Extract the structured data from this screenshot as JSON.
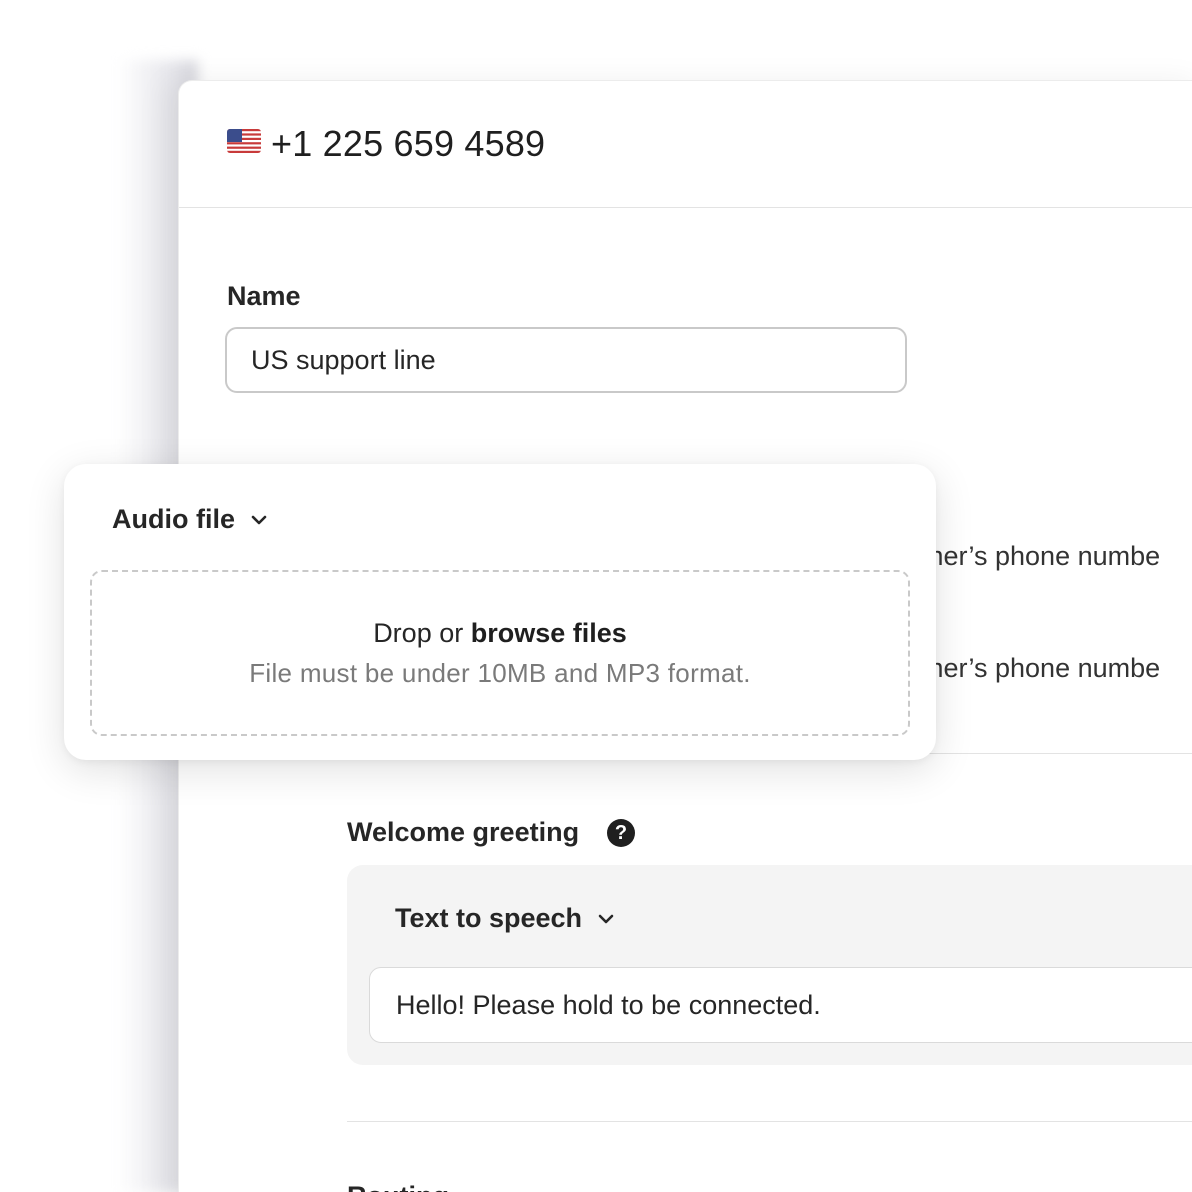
{
  "header": {
    "flag_icon": "us-flag-icon",
    "phone_number": "+1 225 659 4589"
  },
  "name_field": {
    "label": "Name",
    "value": "US support line"
  },
  "partial_text": {
    "line_1": "mer’s phone numbe",
    "line_2": "mer’s phone numbe"
  },
  "welcome_greeting": {
    "label": "Welcome greeting",
    "help_icon": "?",
    "mode_label": "Text to speech",
    "message_value": "Hello! Please hold to be connected."
  },
  "next_section": {
    "label": "Routing"
  },
  "audio_card": {
    "mode_label": "Audio file",
    "drop_text": "Drop or",
    "browse_text": "browse files",
    "hint": "File must be under 10MB and MP3 format."
  },
  "colors": {
    "text": "#1f1f1f",
    "muted": "#7a7a7a",
    "border": "#c9c9c9",
    "panel_bg": "#f4f4f4"
  }
}
